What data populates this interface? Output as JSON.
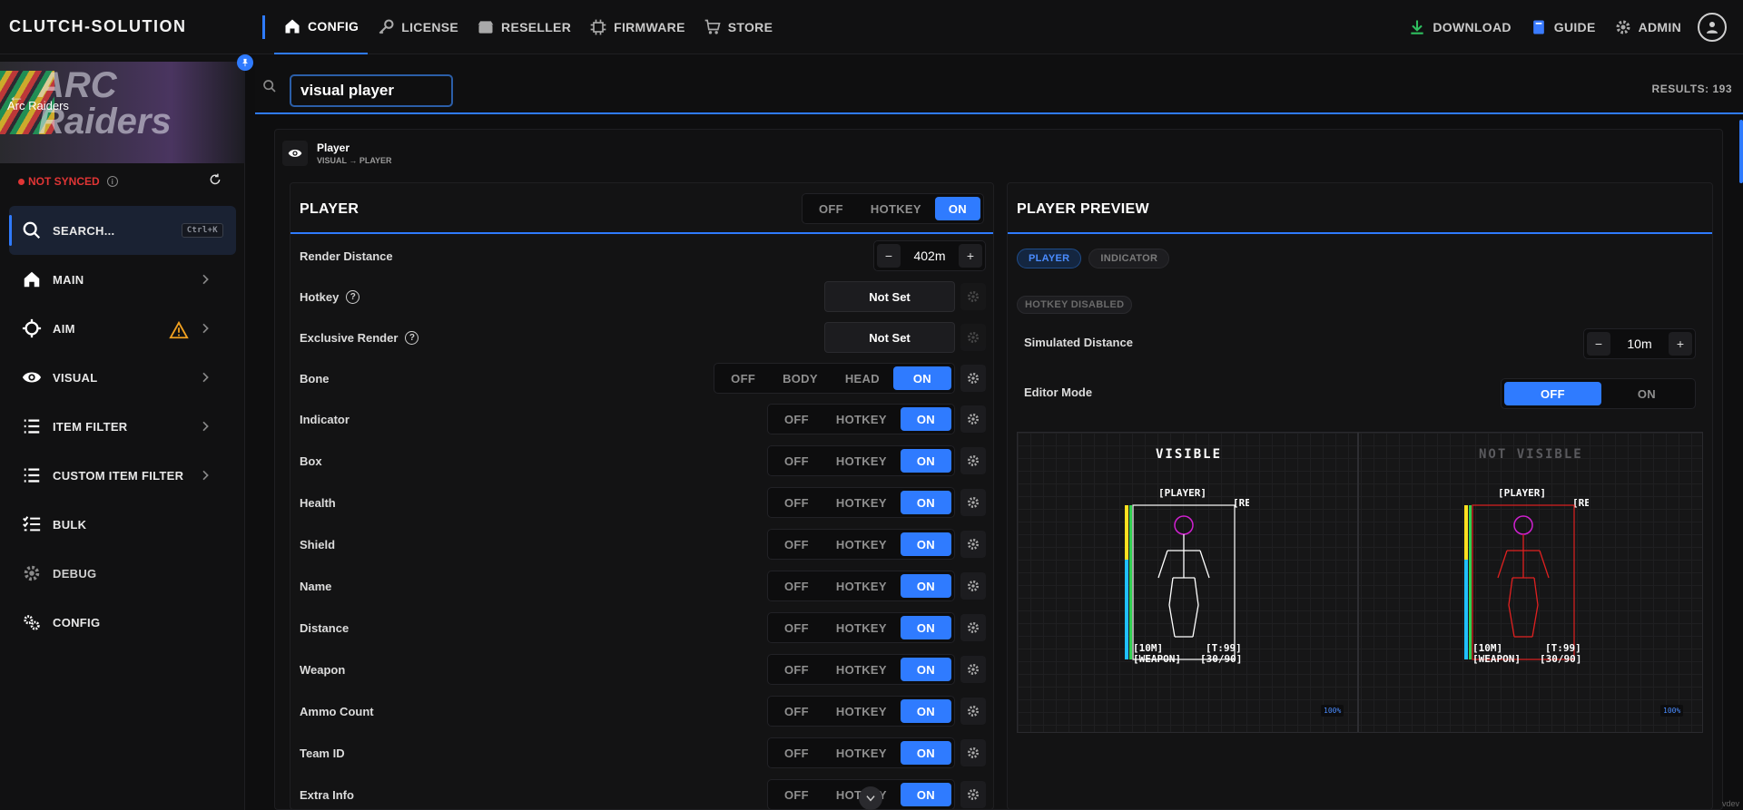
{
  "topbar": {
    "brand": "CLUTCH-SOLUTION",
    "nav": [
      {
        "label": "CONFIG",
        "icon": "home-icon"
      },
      {
        "label": "LICENSE",
        "icon": "key-icon"
      },
      {
        "label": "RESELLER",
        "icon": "store-icon"
      },
      {
        "label": "FIRMWARE",
        "icon": "chip-icon"
      },
      {
        "label": "STORE",
        "icon": "cart-icon"
      }
    ],
    "right": [
      {
        "label": "DOWNLOAD",
        "icon": "download-icon"
      },
      {
        "label": "GUIDE",
        "icon": "book-icon"
      },
      {
        "label": "ADMIN",
        "icon": "gear-icon"
      }
    ]
  },
  "sidebar": {
    "banner_title": "ARC Raiders",
    "game_name": "Arc Raiders",
    "sync_status": "NOT SYNCED",
    "search_label": "SEARCH...",
    "search_shortcut": "Ctrl+K",
    "items": [
      {
        "label": "MAIN",
        "icon": "home-icon"
      },
      {
        "label": "AIM",
        "icon": "crosshair-icon"
      },
      {
        "label": "VISUAL",
        "icon": "eye-icon"
      },
      {
        "label": "ITEM FILTER",
        "icon": "list-icon"
      },
      {
        "label": "CUSTOM ITEM FILTER",
        "icon": "list-icon"
      },
      {
        "label": "BULK",
        "icon": "checklist-icon"
      },
      {
        "label": "DEBUG",
        "icon": "gear-icon"
      },
      {
        "label": "CONFIG",
        "icon": "gears-icon"
      }
    ],
    "colors": {
      "accent": "#2f7bff",
      "warning": "#f0a020",
      "error": "#e03535"
    }
  },
  "search": {
    "value": "visual player",
    "results": "RESULTS: 193"
  },
  "result": {
    "title": "Player",
    "path": "VISUAL → PLAYER"
  },
  "player": {
    "title": "PLAYER",
    "mode_options": [
      "OFF",
      "HOTKEY",
      "ON"
    ],
    "mode_selected": "ON",
    "render_distance_label": "Render Distance",
    "render_distance_value": "402m",
    "hotkey_label": "Hotkey",
    "hotkey_value": "Not Set",
    "exclusive_label": "Exclusive Render",
    "exclusive_value": "Not Set",
    "bone_label": "Bone",
    "bone_options": [
      "OFF",
      "BODY",
      "HEAD",
      "ON"
    ],
    "bone_selected": "ON",
    "toggles": [
      {
        "label": "Indicator",
        "value": "ON"
      },
      {
        "label": "Box",
        "value": "ON"
      },
      {
        "label": "Health",
        "value": "ON"
      },
      {
        "label": "Shield",
        "value": "ON"
      },
      {
        "label": "Name",
        "value": "ON"
      },
      {
        "label": "Distance",
        "value": "ON"
      },
      {
        "label": "Weapon",
        "value": "ON"
      },
      {
        "label": "Ammo Count",
        "value": "ON"
      },
      {
        "label": "Team ID",
        "value": "ON"
      },
      {
        "label": "Extra Info",
        "value": "ON"
      }
    ],
    "toggle_off": "OFF",
    "toggle_hotkey": "HOTKEY",
    "toggle_on": "ON"
  },
  "preview": {
    "title": "PLAYER PREVIEW",
    "pill_player": "PLAYER",
    "pill_indicator": "INDICATOR",
    "hotkey_disabled": "HOTKEY DISABLED",
    "sim_distance_label": "Simulated Distance",
    "sim_distance_value": "10m",
    "editor_mode_label": "Editor Mode",
    "editor_off": "OFF",
    "editor_on": "ON",
    "visible_title": "VISIBLE",
    "not_visible_title": "NOT VISIBLE",
    "tag_player": "[PLAYER]",
    "tag_reload": "[RELOAD]",
    "tag_distance": "[10M]",
    "tag_team": "[T:99]",
    "tag_weapon": "[WEAPON]",
    "tag_ammo": "[30/90]",
    "zoom": "100%",
    "visible_color": "#ffffff",
    "not_visible_color": "#e02020",
    "head_color": "#d020d0"
  },
  "footer": {
    "tag": "vdev"
  }
}
